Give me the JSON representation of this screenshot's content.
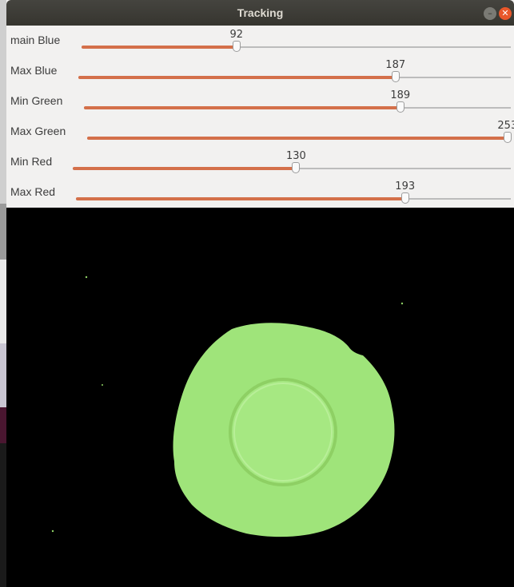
{
  "window": {
    "title": "Tracking",
    "minimize_icon": "minimize-icon",
    "close_icon": "close-icon",
    "minimize_glyph": "–",
    "close_glyph": "✕"
  },
  "sliders": [
    {
      "label": "main Blue",
      "value": "92",
      "max": 255
    },
    {
      "label": "Max Blue",
      "value": "187",
      "max": 255
    },
    {
      "label": "Min Green",
      "value": "189",
      "max": 255
    },
    {
      "label": "Max Green",
      "value": "253",
      "max": 255
    },
    {
      "label": "Min Red",
      "value": "130",
      "max": 255
    },
    {
      "label": "Max Red",
      "value": "193",
      "max": 255
    }
  ],
  "colors": {
    "slider_fill": "#d4704a",
    "mask_background": "#000000",
    "detected_object": "#9fe47a"
  }
}
